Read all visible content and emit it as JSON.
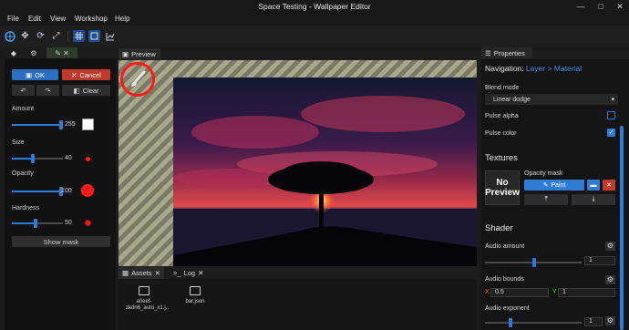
{
  "window": {
    "title": "Space Testing - Wallpaper Editor"
  },
  "menu": [
    "File",
    "Edit",
    "View",
    "Workshop",
    "Help"
  ],
  "left_panel": {
    "ok_label": "OK",
    "cancel_label": "Cancel",
    "clear_label": "Clear",
    "amount": {
      "label": "Amount",
      "value": "255",
      "fraction": 1.0
    },
    "size": {
      "label": "Size",
      "value": "40",
      "fraction": 0.45
    },
    "opacity": {
      "label": "Opacity",
      "value": "100",
      "fraction": 1.0
    },
    "hardness": {
      "label": "Hardness",
      "value": "50",
      "fraction": 0.5
    },
    "show_mask_label": "Show mask"
  },
  "preview": {
    "tab_label": "Preview"
  },
  "bottom": {
    "tabs": [
      {
        "label": "Assets"
      },
      {
        "label": "Log"
      }
    ],
    "assets": [
      {
        "name": "a0eef-\nzkdn6_auto_x1.j.."
      },
      {
        "name": "bar.json"
      }
    ]
  },
  "properties": {
    "tab_label": "Properties",
    "breadcrumb_prefix": "Navigation:",
    "breadcrumb_layer": "Layer",
    "breadcrumb_sep": ">",
    "breadcrumb_material": "Material",
    "blend_mode_label": "Blend mode",
    "blend_mode_value": "Linear dodge",
    "pulse_alpha_label": "Pulse alpha",
    "pulse_alpha_checked": false,
    "pulse_color_label": "Pulse color",
    "pulse_color_checked": true,
    "textures_heading": "Textures",
    "no_preview_label": "No Preview",
    "opacity_mask_label": "Opacity mask",
    "paint_label": "Paint",
    "shader_heading": "Shader",
    "audio_amount_label": "Audio amount",
    "audio_amount_value": "1",
    "audio_bounds_label": "Audio bounds",
    "audio_bounds_x_label": "X",
    "audio_bounds_x": "0.5",
    "audio_bounds_y_label": "Y",
    "audio_bounds_y": "1",
    "audio_exponent_label": "Audio exponent",
    "audio_exponent_value": "1"
  },
  "colors": {
    "accent": "#2f7cd6",
    "ok": "#2b6fc4",
    "cancel": "#c0392b",
    "brush": "#ff1a1a"
  }
}
